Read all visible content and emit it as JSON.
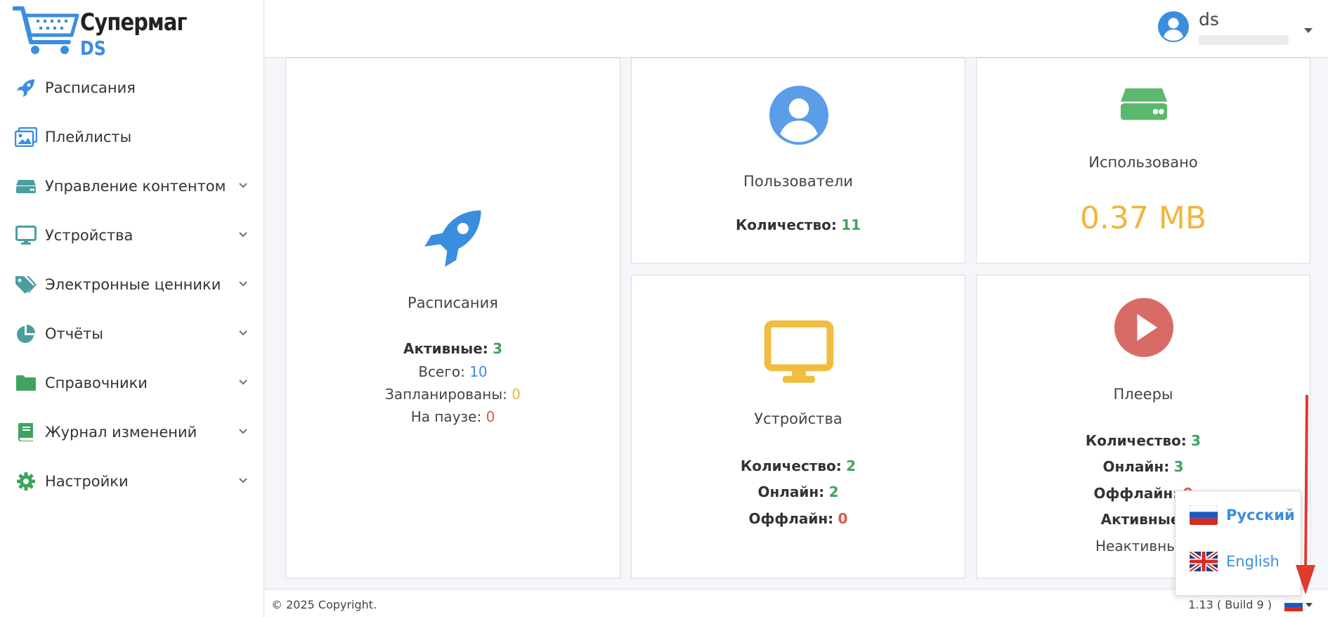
{
  "brand": {
    "line1": "Супермаг",
    "line2": "DS"
  },
  "sidebar": {
    "items": [
      {
        "label": "Расписания",
        "icon": "rocket-icon",
        "expandable": false
      },
      {
        "label": "Плейлисты",
        "icon": "images-icon",
        "expandable": false
      },
      {
        "label": "Управление контентом",
        "icon": "hdd-icon",
        "expandable": true
      },
      {
        "label": "Устройства",
        "icon": "monitor-icon",
        "expandable": true
      },
      {
        "label": "Электронные ценники",
        "icon": "tags-icon",
        "expandable": true
      },
      {
        "label": "Отчёты",
        "icon": "pie-chart-icon",
        "expandable": true
      },
      {
        "label": "Справочники",
        "icon": "folder-icon",
        "expandable": true
      },
      {
        "label": "Журнал изменений",
        "icon": "book-icon",
        "expandable": true
      },
      {
        "label": "Настройки",
        "icon": "gear-icon",
        "expandable": true
      }
    ]
  },
  "header": {
    "username": "ds"
  },
  "cards": {
    "schedules": {
      "title": "Расписания",
      "active_label": "Активные:",
      "active_value": "3",
      "total_label": "Всего:",
      "total_value": "10",
      "planned_label": "Запланированы:",
      "planned_value": "0",
      "paused_label": "На паузе:",
      "paused_value": "0"
    },
    "users": {
      "title": "Пользователи",
      "count_label": "Количество:",
      "count_value": "11"
    },
    "storage": {
      "title": "Использовано",
      "value": "0.37 MB"
    },
    "devices": {
      "title": "Устройства",
      "count_label": "Количество:",
      "count_value": "2",
      "online_label": "Онлайн:",
      "online_value": "2",
      "offline_label": "Оффлайн:",
      "offline_value": "0"
    },
    "players": {
      "title": "Плееры",
      "count_label": "Количество:",
      "count_value": "3",
      "online_label": "Онлайн:",
      "online_value": "3",
      "offline_label": "Оффлайн:",
      "offline_value": "0",
      "active_label": "Активные:",
      "inactive_label": "Неактивные:"
    }
  },
  "footer": {
    "copyright": "© 2025 Copyright.",
    "version": "1.13 ( Build 9 )"
  },
  "language_menu": {
    "items": [
      {
        "label": "Русский",
        "flag": "russia-flag-icon",
        "selected": true
      },
      {
        "label": "English",
        "flag": "uk-flag-icon",
        "selected": false
      }
    ]
  },
  "colors": {
    "blue": "#3b8de0",
    "green": "#3fa35d",
    "yellow": "#f0b63a",
    "red": "#d85a4f",
    "teal": "#4a9ea0"
  }
}
